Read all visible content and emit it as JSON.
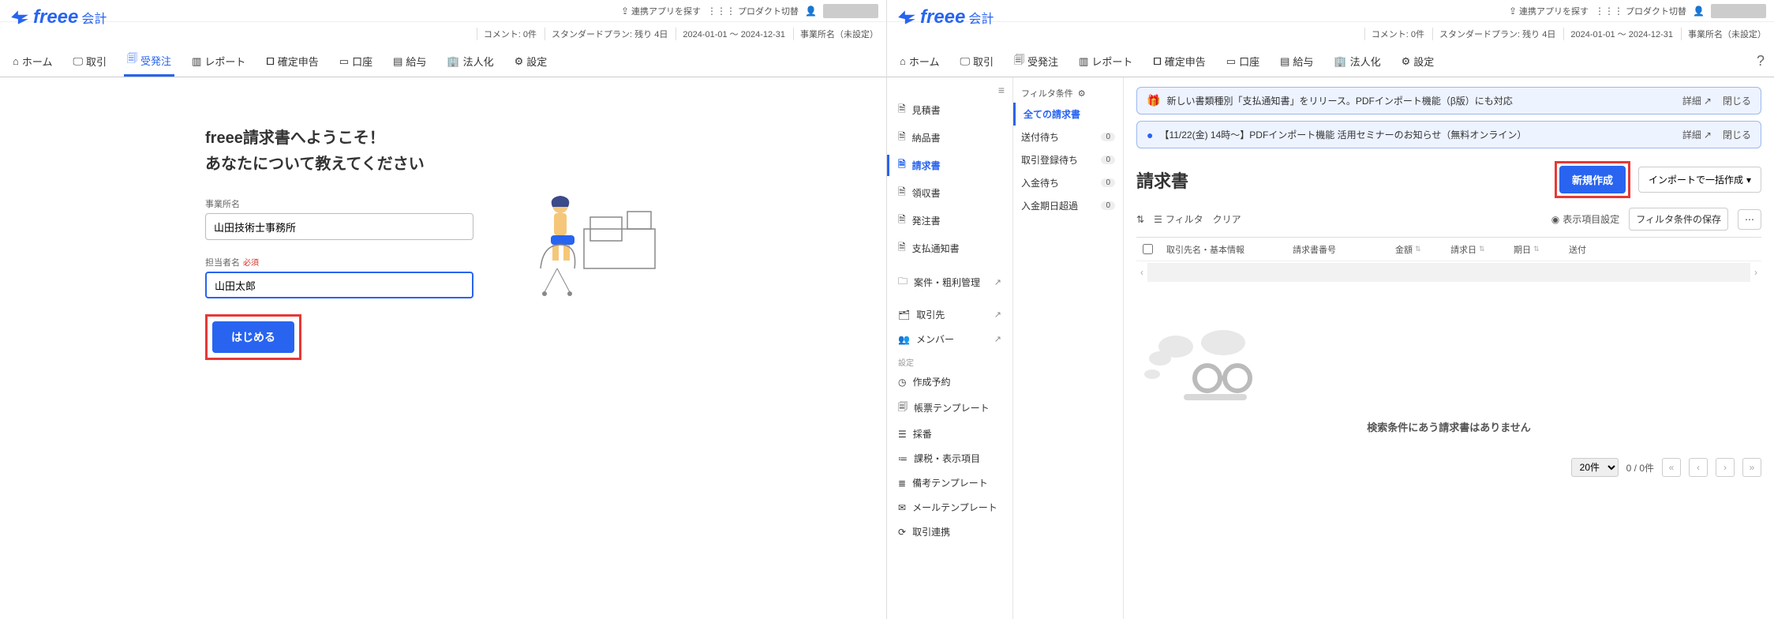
{
  "brand": {
    "name": "freee",
    "sub": "会計"
  },
  "topbar": {
    "find_apps": "連携アプリを探す",
    "switch_product": "プロダクト切替"
  },
  "status": {
    "comments": "コメント: 0件",
    "plan": "スタンダードプラン: 残り 4日",
    "period": "2024-01-01 ～ 2024-12-31",
    "office": "事業所名（未設定）"
  },
  "nav": [
    {
      "label": "ホーム",
      "icon": "home"
    },
    {
      "label": "取引",
      "icon": "monitor"
    },
    {
      "label": "受発注",
      "icon": "doc"
    },
    {
      "label": "レポート",
      "icon": "chart"
    },
    {
      "label": "確定申告",
      "icon": "stamp"
    },
    {
      "label": "口座",
      "icon": "card"
    },
    {
      "label": "給与",
      "icon": "pay"
    },
    {
      "label": "法人化",
      "icon": "building"
    },
    {
      "label": "設定",
      "icon": "gear"
    }
  ],
  "welcome": {
    "title1": "freee請求書へようこそ！",
    "title2": "あなたについて教えてください",
    "office_label": "事業所名",
    "office_value": "山田技術士事務所",
    "person_label": "担当者名",
    "required": "必須",
    "person_value": "山田太郎",
    "start_button": "はじめる"
  },
  "sidebar": {
    "items": [
      {
        "label": "見積書",
        "icon": "doc"
      },
      {
        "label": "納品書",
        "icon": "doc"
      },
      {
        "label": "請求書",
        "icon": "doc",
        "active": true
      },
      {
        "label": "領収書",
        "icon": "doc"
      },
      {
        "label": "発注書",
        "icon": "doc"
      },
      {
        "label": "支払通知書",
        "icon": "doc"
      }
    ],
    "manage": {
      "label": "案件・粗利管理",
      "ext": true
    },
    "partners": {
      "label": "取引先",
      "ext": true
    },
    "members": {
      "label": "メンバー",
      "ext": true
    },
    "settings_label": "設定",
    "settings": [
      {
        "label": "作成予約",
        "icon": "clock"
      },
      {
        "label": "帳票テンプレート",
        "icon": "template"
      },
      {
        "label": "採番",
        "icon": "list"
      },
      {
        "label": "課税・表示項目",
        "icon": "tax"
      },
      {
        "label": "備考テンプレート",
        "icon": "note"
      },
      {
        "label": "メールテンプレート",
        "icon": "mail"
      },
      {
        "label": "取引連携",
        "icon": "sync"
      }
    ]
  },
  "banners": [
    {
      "icon": "gift",
      "text": "新しい書類種別「支払通知書」をリリース。PDFインポート機能（β版）にも対応",
      "detail": "詳細",
      "close": "閉じる"
    },
    {
      "icon": "info",
      "text": "【11/22(金) 14時～】PDFインポート機能 活用セミナーのお知らせ（無料オンライン）",
      "detail": "詳細",
      "close": "閉じる"
    }
  ],
  "page": {
    "title": "請求書",
    "new_button": "新規作成",
    "import_button": "インポートで一括作成"
  },
  "filters": {
    "header": "フィルタ条件",
    "items": [
      {
        "label": "全ての請求書",
        "active": true
      },
      {
        "label": "送付待ち",
        "count": 0
      },
      {
        "label": "取引登録待ち",
        "count": 0
      },
      {
        "label": "入金待ち",
        "count": 0
      },
      {
        "label": "入金期日超過",
        "count": 0
      }
    ]
  },
  "toolbar": {
    "sort": "",
    "filter": "フィルタ",
    "clear": "クリア",
    "columns": "表示項目設定",
    "save_filter": "フィルタ条件の保存"
  },
  "table": {
    "columns": [
      "取引先名・基本情報",
      "請求書番号",
      "金額",
      "請求日",
      "期日",
      "送付"
    ]
  },
  "empty": {
    "text": "検索条件にあう請求書はありません"
  },
  "pager": {
    "page_size": "20件",
    "range": "0 / 0件"
  }
}
